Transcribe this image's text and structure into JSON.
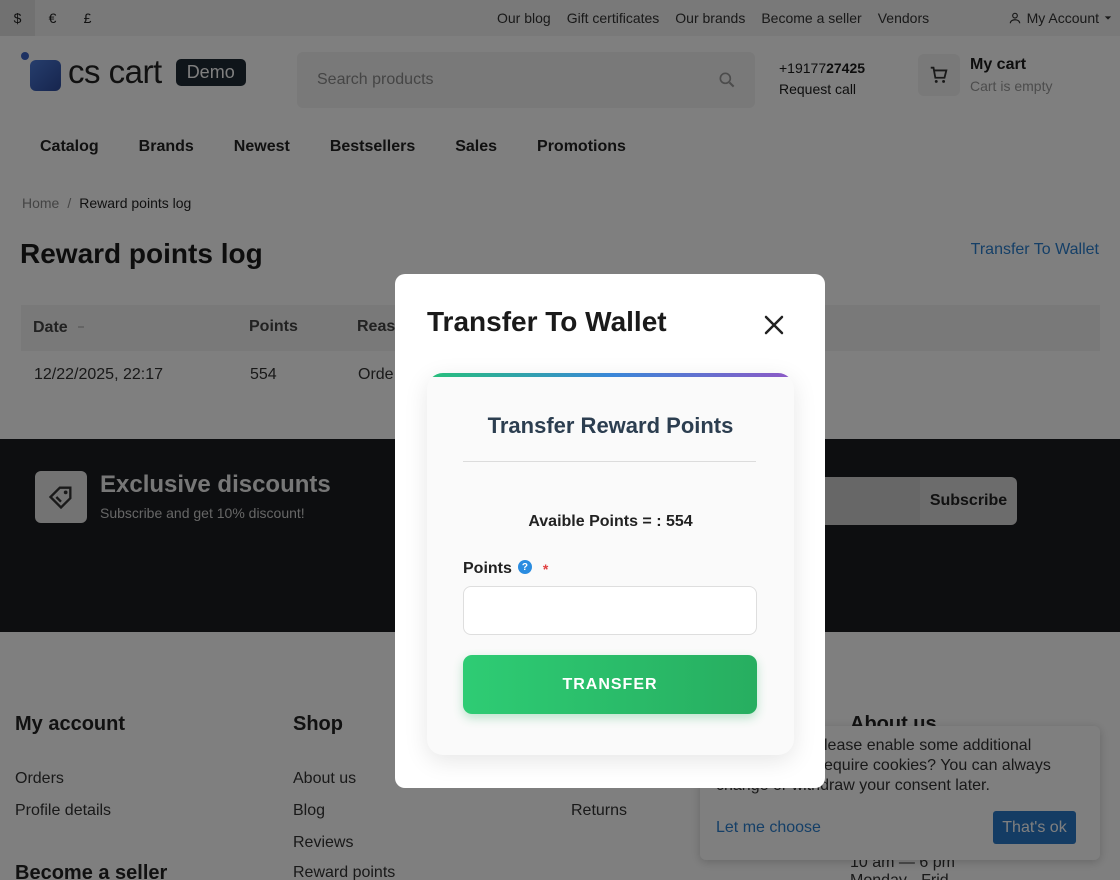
{
  "topbar": {
    "currencies": [
      "$",
      "€",
      "£"
    ],
    "links": [
      "Our blog",
      "Gift certificates",
      "Our brands",
      "Become a seller",
      "Vendors"
    ],
    "account_label": "My Account"
  },
  "header": {
    "logo_text": "cs cart",
    "demo_badge": "Demo",
    "search_placeholder": "Search products",
    "phone_prefix": "+19177",
    "phone_bold": "27425",
    "request_call": "Request call",
    "cart_title": "My cart",
    "cart_status": "Cart is empty"
  },
  "nav": [
    "Catalog",
    "Brands",
    "Newest",
    "Bestsellers",
    "Sales",
    "Promotions"
  ],
  "breadcrumb": {
    "home": "Home",
    "separator": "/",
    "current": "Reward points log"
  },
  "page": {
    "title": "Reward points log",
    "transfer_link": "Transfer To Wallet"
  },
  "table": {
    "headers": {
      "date": "Date",
      "points": "Points",
      "reason": "Reas"
    },
    "rows": [
      {
        "date": "12/22/2025, 22:17",
        "points": "554",
        "reason": "Orde"
      }
    ]
  },
  "promo": {
    "title": "Exclusive discounts",
    "subtitle": "Subscribe and get 10% discount!",
    "subscribe_label": "Subscribe"
  },
  "footer": {
    "my_account": {
      "title": "My account",
      "links": [
        "Orders",
        "Profile details"
      ]
    },
    "become_seller": "Become a seller",
    "shop": {
      "title": "Shop",
      "links": [
        "About us",
        "Blog",
        "Reviews",
        "Reward points"
      ]
    },
    "col3_link": "Returns",
    "about_title": "About us",
    "hours": "10 am — 6 pm",
    "days": "Monday - Frid"
  },
  "cookie": {
    "text": "lease enable some additional equire cookies? You can always change or withdraw your consent later.",
    "line1": "lease enable some additional",
    "line2": "equire cookies? You can always",
    "line3": "change or withdraw your consent later.",
    "choose_label": "Let me choose",
    "ok_label": "That's ok"
  },
  "modal": {
    "title": "Transfer To Wallet",
    "card_title": "Transfer Reward Points",
    "available_text": "Avaible Points = : 554",
    "points_label": "Points",
    "help_symbol": "?",
    "required_mark": "*",
    "points_value": "",
    "transfer_button": "TRANSFER"
  }
}
